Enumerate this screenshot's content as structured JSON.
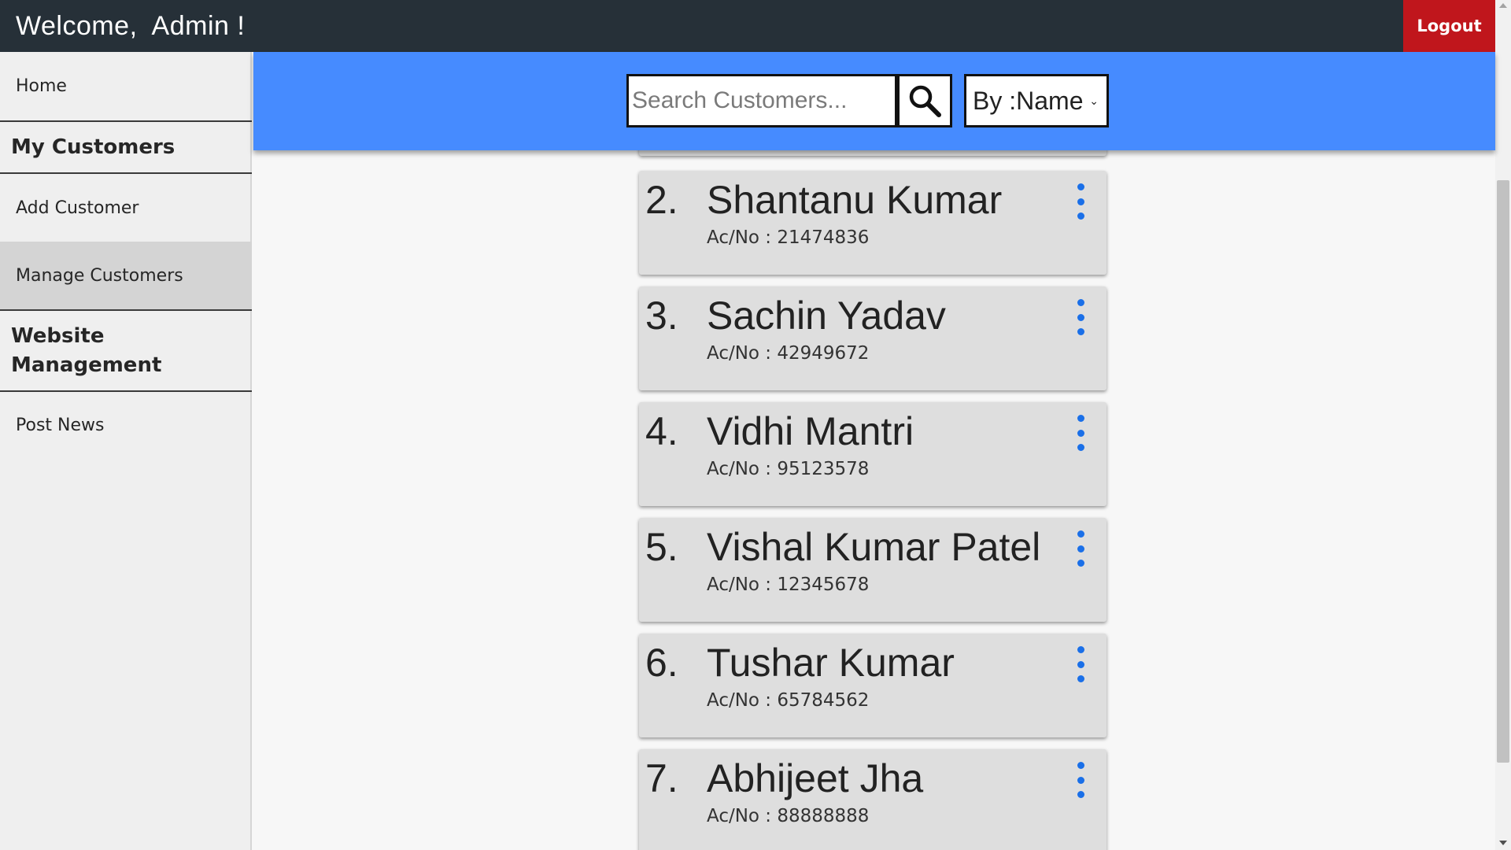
{
  "header": {
    "welcome_text": "Welcome,  Admin !",
    "logout_label": "Logout"
  },
  "sidebar": {
    "items": [
      {
        "label": "Home",
        "type": "link"
      },
      {
        "label": "My Customers",
        "type": "heading"
      },
      {
        "label": "Add Customer",
        "type": "link"
      },
      {
        "label": "Manage Customers",
        "type": "link",
        "active": true
      },
      {
        "label": "Website Management",
        "type": "heading"
      },
      {
        "label": "Post News",
        "type": "link"
      }
    ]
  },
  "search": {
    "placeholder": "Search Customers...",
    "value": "",
    "sort_selected": "By :Name"
  },
  "customers": [
    {
      "index": "2.",
      "name": "Shantanu Kumar",
      "account": "Ac/No : 21474836"
    },
    {
      "index": "3.",
      "name": "Sachin Yadav",
      "account": "Ac/No : 42949672"
    },
    {
      "index": "4.",
      "name": "Vidhi Mantri",
      "account": "Ac/No : 95123578"
    },
    {
      "index": "5.",
      "name": "Vishal Kumar Patel",
      "account": "Ac/No : 12345678"
    },
    {
      "index": "6.",
      "name": "Tushar Kumar",
      "account": "Ac/No : 65784562"
    },
    {
      "index": "7.",
      "name": "Abhijeet Jha",
      "account": "Ac/No : 88888888"
    }
  ],
  "icons": {
    "search": "search-icon",
    "card_menu": "kebab-menu-icon",
    "sort_dropdown": "chevron-down-icon"
  },
  "colors": {
    "header_bg": "#263038",
    "logout_bg": "#c0161c",
    "band_bg": "#468bff",
    "menu_dots": "#1a6fe8"
  }
}
